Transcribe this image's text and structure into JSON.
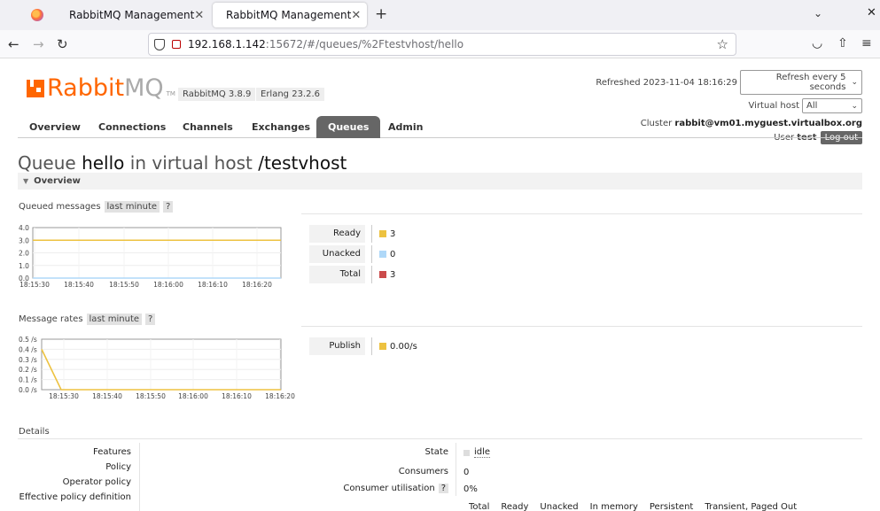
{
  "browser": {
    "tabs": [
      {
        "title": "RabbitMQ Management",
        "active": false
      },
      {
        "title": "RabbitMQ Management",
        "active": true
      }
    ],
    "url_host": "192.168.1.142",
    "url_rest": ":15672/#/queues/%2Ftestvhost/hello"
  },
  "header": {
    "logo_rabbit": "Rabbit",
    "logo_mq": "MQ",
    "logo_tm": "TM",
    "rabbitmq_version": "RabbitMQ 3.8.9",
    "erlang_version": "Erlang 23.2.6",
    "refreshed_label": "Refreshed 2023-11-04 18:16:29",
    "refresh_select": "Refresh every 5 seconds",
    "vhost_label": "Virtual host",
    "vhost_select": "All",
    "cluster_label": "Cluster",
    "cluster_name": "rabbit@vm01.myguest.virtualbox.org",
    "user_label": "User",
    "user_name": "test",
    "logout_label": "Log out"
  },
  "nav": {
    "items": [
      "Overview",
      "Connections",
      "Channels",
      "Exchanges",
      "Queues",
      "Admin"
    ],
    "active": "Queues"
  },
  "page": {
    "title_prefix": "Queue",
    "queue_name": "hello",
    "title_mid": "in virtual host",
    "vhost_name": "/testvhost",
    "section_overview": "Overview"
  },
  "queued_messages": {
    "label": "Queued messages",
    "range": "last minute",
    "help": "?",
    "legend": [
      {
        "name": "Ready",
        "value": "3",
        "color": "#edc240"
      },
      {
        "name": "Unacked",
        "value": "0",
        "color": "#afd8f8"
      },
      {
        "name": "Total",
        "value": "3",
        "color": "#cb4b4b"
      }
    ]
  },
  "message_rates": {
    "label": "Message rates",
    "range": "last minute",
    "help": "?",
    "legend": [
      {
        "name": "Publish",
        "value": "0.00/s",
        "color": "#edc240"
      }
    ]
  },
  "chart_data": [
    {
      "type": "line",
      "yticks": [
        "4.0",
        "3.0",
        "2.0",
        "1.0",
        "0.0"
      ],
      "xticks": [
        "18:15:30",
        "18:15:40",
        "18:15:50",
        "18:16:00",
        "18:16:10",
        "18:16:20"
      ],
      "ylim": [
        0,
        4
      ],
      "series": [
        {
          "name": "Total",
          "color": "#cb4b4b",
          "values": [
            3,
            3
          ]
        },
        {
          "name": "Ready",
          "color": "#edc240",
          "values": [
            3,
            3
          ]
        },
        {
          "name": "Unacked",
          "color": "#afd8f8",
          "values": [
            0,
            0
          ]
        }
      ]
    },
    {
      "type": "line",
      "yticks": [
        "0.5 /s",
        "0.4 /s",
        "0.3 /s",
        "0.2 /s",
        "0.1 /s",
        "0.0 /s"
      ],
      "xticks": [
        "18:15:30",
        "18:15:40",
        "18:15:50",
        "18:16:00",
        "18:16:10",
        "18:16:20"
      ],
      "ylim": [
        0,
        0.5
      ],
      "series": [
        {
          "name": "Publish",
          "color": "#edc240",
          "values": [
            0.4,
            0.0,
            0.0
          ]
        }
      ]
    }
  ],
  "details": {
    "label": "Details",
    "left_keys": [
      "Features",
      "Policy",
      "Operator policy",
      "Effective policy definition"
    ],
    "state_label": "State",
    "state_value": "idle",
    "consumers_label": "Consumers",
    "consumers_value": "0",
    "consumer_util_label": "Consumer utilisation",
    "consumer_util_help": "?",
    "consumer_util_value": "0%",
    "table_headers": [
      "Total",
      "Ready",
      "Unacked",
      "In memory",
      "Persistent",
      "Transient, Paged Out"
    ]
  }
}
